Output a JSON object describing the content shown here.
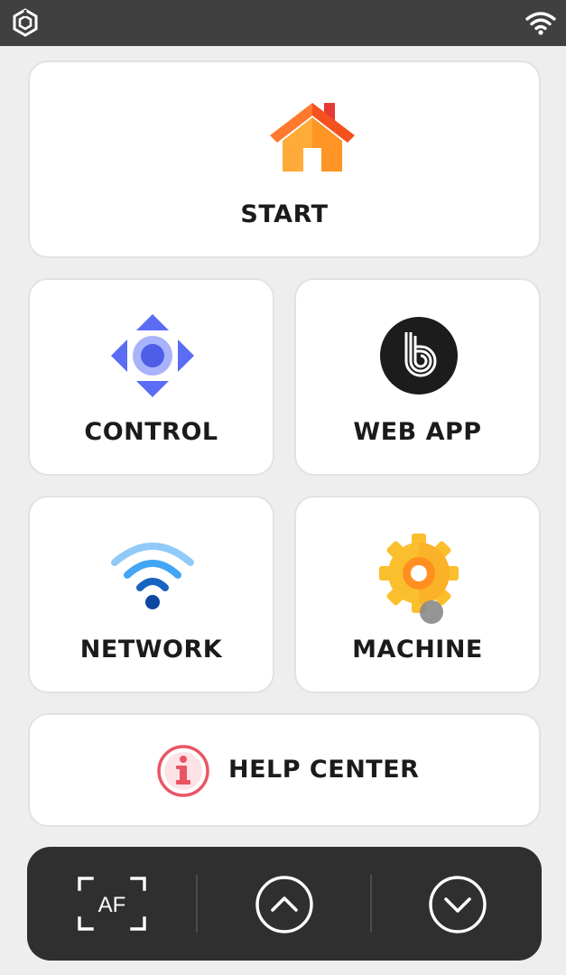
{
  "status_bar": {
    "logo_icon": "app-logo-icon",
    "wifi_icon": "wifi-status-icon"
  },
  "menu": {
    "start_label": "START",
    "control_label": "CONTROL",
    "webapp_label": "WEB APP",
    "network_label": "NETWORK",
    "machine_label": "MACHINE",
    "help_label": "HELP CENTER"
  },
  "toolbar": {
    "autofocus_label": "AF",
    "up_icon": "chevron-up-circle-icon",
    "down_icon": "chevron-down-circle-icon"
  },
  "colors": {
    "status_bar_bg": "#404040",
    "background": "#eeeeee",
    "toolbar_bg": "#2f2f2f",
    "control_icon": "#5b6cf5",
    "network_icon": "#1565c0",
    "machine_icon": "#fbbf2d",
    "help_icon": "#ea5565"
  }
}
